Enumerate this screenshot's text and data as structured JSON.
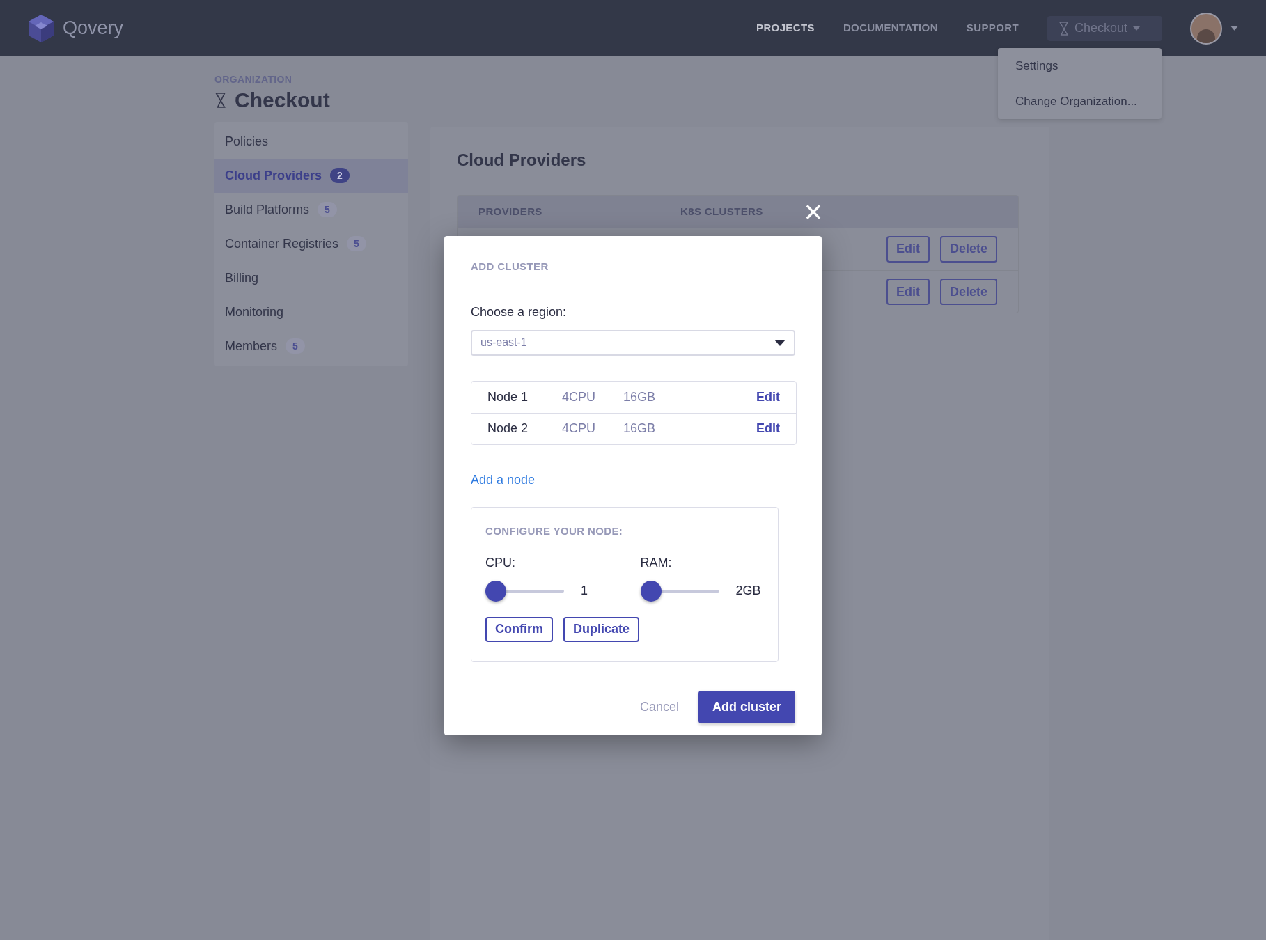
{
  "header": {
    "brand": "Qovery",
    "nav": [
      {
        "label": "PROJECTS",
        "selected": true
      },
      {
        "label": "DOCUMENTATION",
        "selected": false
      },
      {
        "label": "SUPPORT",
        "selected": false
      }
    ],
    "org_switcher": "Checkout",
    "menu": [
      "Settings",
      "Change Organization..."
    ]
  },
  "organization": {
    "label": "ORGANIZATION",
    "name": "Checkout"
  },
  "sidebar": {
    "items": [
      {
        "label": "Policies",
        "selected": false
      },
      {
        "label": "Cloud Providers",
        "badge": "2",
        "selected": true
      },
      {
        "label": "Build Platforms",
        "badge": "5",
        "selected": false
      },
      {
        "label": "Container Registries",
        "badge": "5",
        "selected": false
      },
      {
        "label": "Billing",
        "selected": false
      },
      {
        "label": "Monitoring",
        "selected": false
      },
      {
        "label": "Members",
        "badge": "5",
        "selected": false
      }
    ]
  },
  "main": {
    "title": "Cloud Providers",
    "table": {
      "columns": [
        "PROVIDERS",
        "K8S CLUSTERS"
      ],
      "rows": [
        {
          "actions": [
            "Edit",
            "Delete"
          ]
        },
        {
          "actions": [
            "Edit",
            "Delete"
          ]
        }
      ]
    }
  },
  "modal": {
    "title": "ADD CLUSTER",
    "close": "×",
    "region_label": "Choose a region:",
    "region": "us-east-1",
    "nodes": [
      {
        "name": "Node 1",
        "cpu": "4CPU",
        "ram": "16GB",
        "action": "Edit"
      },
      {
        "name": "Node 2",
        "cpu": "4CPU",
        "ram": "16GB",
        "action": "Edit"
      }
    ],
    "add_node": "Add a node",
    "config": {
      "title": "CONFIGURE YOUR NODE:",
      "sliders": [
        {
          "label": "CPU:",
          "level": 0,
          "reading": "1"
        },
        {
          "label": "RAM:",
          "level": 0,
          "reading": "2GB"
        }
      ],
      "buttons": [
        "Confirm",
        "Duplicate"
      ]
    },
    "cancel": "Cancel",
    "submit": "Add cluster"
  }
}
